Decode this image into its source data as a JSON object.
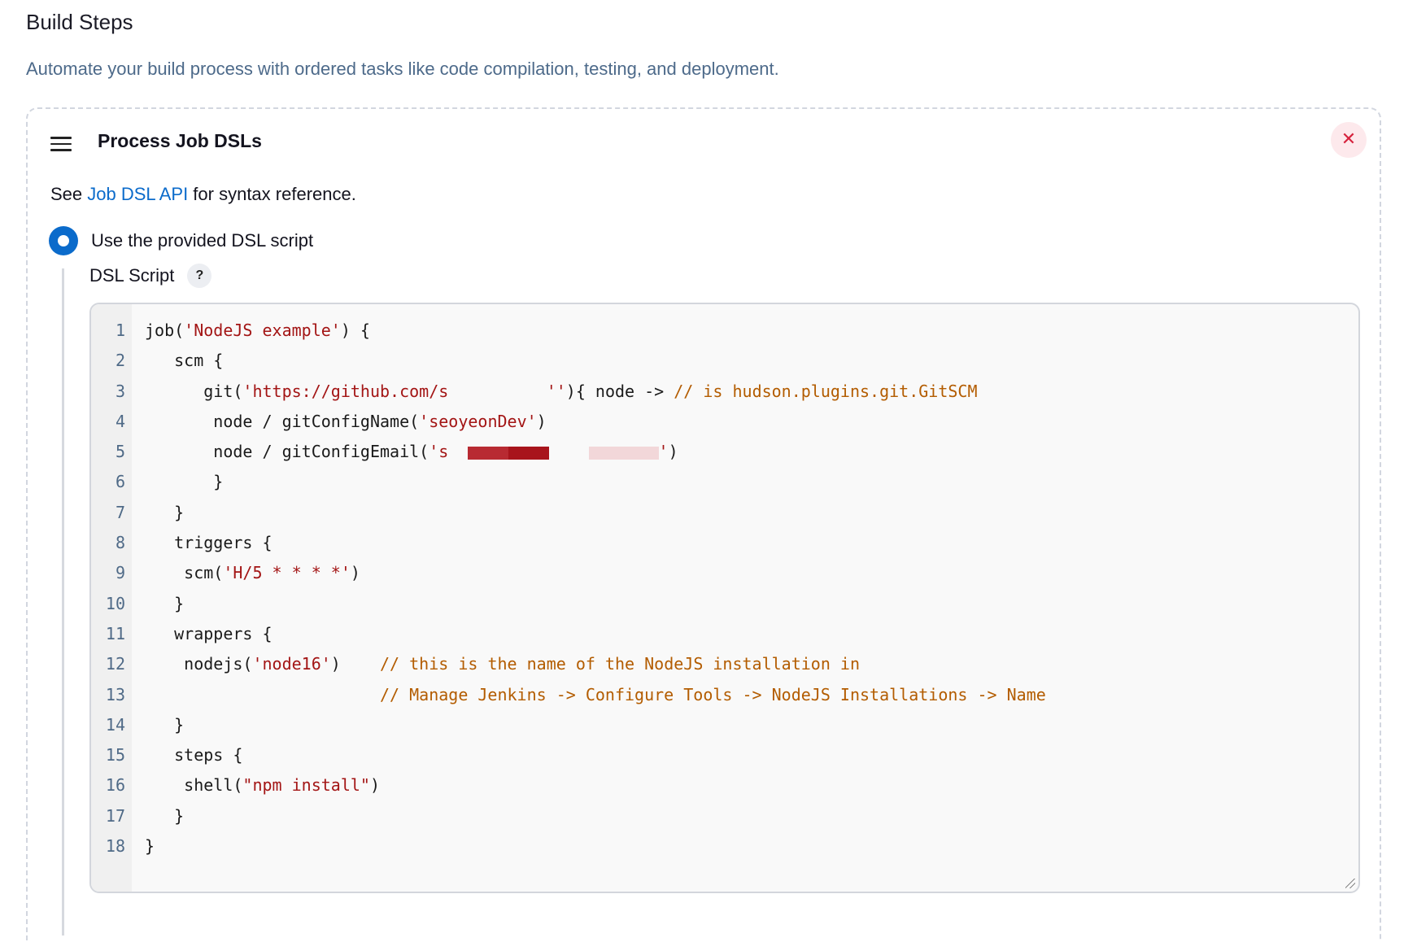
{
  "section": {
    "title": "Build Steps",
    "description": "Automate your build process with ordered tasks like code compilation, testing, and deployment."
  },
  "step": {
    "title": "Process Job DSLs",
    "close_label": "✕",
    "reference": {
      "prefix": "See ",
      "link_text": "Job DSL API",
      "suffix": " for syntax reference."
    },
    "option_selected": "Use the provided DSL script",
    "field_label": "DSL Script",
    "help_label": "?"
  },
  "code": {
    "line_numbers": [
      "1",
      "2",
      "3",
      "4",
      "5",
      "6",
      "7",
      "8",
      "9",
      "10",
      "11",
      "12",
      "13",
      "14",
      "15",
      "16",
      "17",
      "18"
    ],
    "lines": [
      [
        {
          "t": "job(",
          "c": ""
        },
        {
          "t": "'NodeJS example'",
          "c": "str"
        },
        {
          "t": ") {",
          "c": ""
        }
      ],
      [
        {
          "t": "   scm {",
          "c": ""
        }
      ],
      [
        {
          "t": "      git(",
          "c": ""
        },
        {
          "t": "'https://github.com/s          ''",
          "c": "str"
        },
        {
          "t": "){ node -> ",
          "c": ""
        },
        {
          "t": "// is hudson.plugins.git.GitSCM",
          "c": "cmt"
        }
      ],
      [
        {
          "t": "       node / gitConfigName(",
          "c": ""
        },
        {
          "t": "'seoyeonDev'",
          "c": "str"
        },
        {
          "t": ")",
          "c": ""
        }
      ],
      [
        {
          "t": "       node / gitConfigEmail(",
          "c": ""
        },
        {
          "t": "'s  ",
          "c": "str"
        },
        {
          "t": "",
          "c": "redact-a"
        },
        {
          "t": "    ",
          "c": ""
        },
        {
          "t": "",
          "c": "redact-b"
        },
        {
          "t": "'",
          "c": "str"
        },
        {
          "t": ")",
          "c": ""
        }
      ],
      [
        {
          "t": "       }",
          "c": ""
        }
      ],
      [
        {
          "t": "   }",
          "c": ""
        }
      ],
      [
        {
          "t": "   triggers {",
          "c": ""
        }
      ],
      [
        {
          "t": "    scm(",
          "c": ""
        },
        {
          "t": "'H/5 * * * *'",
          "c": "str"
        },
        {
          "t": ")",
          "c": ""
        }
      ],
      [
        {
          "t": "   }",
          "c": ""
        }
      ],
      [
        {
          "t": "   wrappers {",
          "c": ""
        }
      ],
      [
        {
          "t": "    nodejs(",
          "c": ""
        },
        {
          "t": "'node16'",
          "c": "str"
        },
        {
          "t": ")    ",
          "c": ""
        },
        {
          "t": "// this is the name of the NodeJS installation in",
          "c": "cmt"
        }
      ],
      [
        {
          "t": "                        ",
          "c": ""
        },
        {
          "t": "// Manage Jenkins -> Configure Tools -> NodeJS Installations -> Name",
          "c": "cmt"
        }
      ],
      [
        {
          "t": "   }",
          "c": ""
        }
      ],
      [
        {
          "t": "   steps {",
          "c": ""
        }
      ],
      [
        {
          "t": "    shell(",
          "c": ""
        },
        {
          "t": "\"npm install\"",
          "c": "str"
        },
        {
          "t": ")",
          "c": ""
        }
      ],
      [
        {
          "t": "   }",
          "c": ""
        }
      ],
      [
        {
          "t": "}",
          "c": ""
        }
      ]
    ]
  },
  "colors": {
    "accent": "#0b6bcb",
    "string": "#a31515",
    "comment": "#b35c00",
    "description": "#4d6a8a",
    "close": "#d6223d"
  }
}
